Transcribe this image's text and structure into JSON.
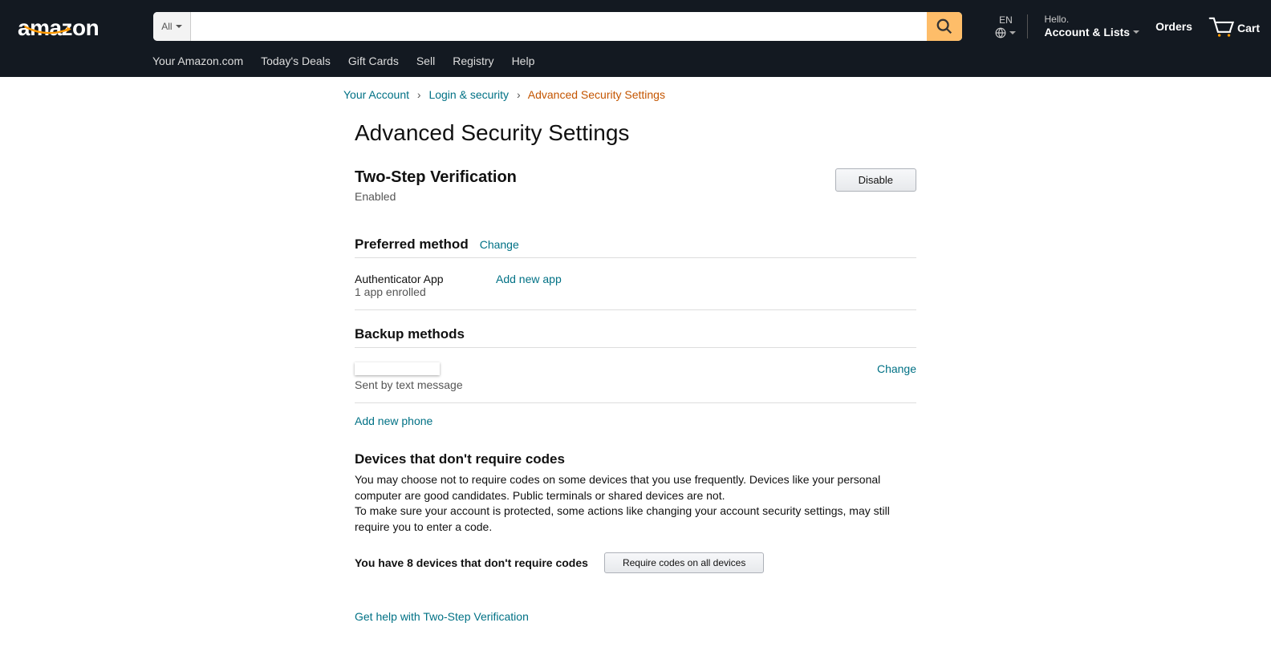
{
  "header": {
    "logo_text": "amazon",
    "search_category": "All",
    "lang": "EN",
    "greeting": "Hello.",
    "account_label": "Account & Lists",
    "orders_label": "Orders",
    "cart_label": "Cart",
    "sub_nav": {
      "your_amazon": "Your Amazon.com",
      "todays_deals": "Today's Deals",
      "gift_cards": "Gift Cards",
      "sell": "Sell",
      "registry": "Registry",
      "help": "Help"
    }
  },
  "breadcrumb": {
    "your_account": "Your Account",
    "login_security": "Login & security",
    "current": "Advanced Security Settings"
  },
  "page": {
    "title": "Advanced Security Settings",
    "tsv_heading": "Two-Step Verification",
    "tsv_status": "Enabled",
    "disable_button": "Disable",
    "preferred_heading": "Preferred method",
    "change_link": "Change",
    "preferred_method_name": "Authenticator App",
    "preferred_method_sub": "1 app enrolled",
    "add_new_app": "Add new app",
    "backup_heading": "Backup methods",
    "backup_sub": "Sent by text message",
    "backup_change": "Change",
    "add_new_phone": "Add new phone",
    "devices_heading": "Devices that don't require codes",
    "devices_p1": "You may choose not to require codes on some devices that you use frequently. Devices like your personal computer are good candidates. Public terminals or shared devices are not.",
    "devices_p2": "To make sure your account is protected, some actions like changing your account security settings, may still require you to enter a code.",
    "devices_count": "You have 8 devices that don't require codes",
    "require_codes_button": "Require codes on all devices",
    "help_link": "Get help with Two-Step Verification"
  }
}
